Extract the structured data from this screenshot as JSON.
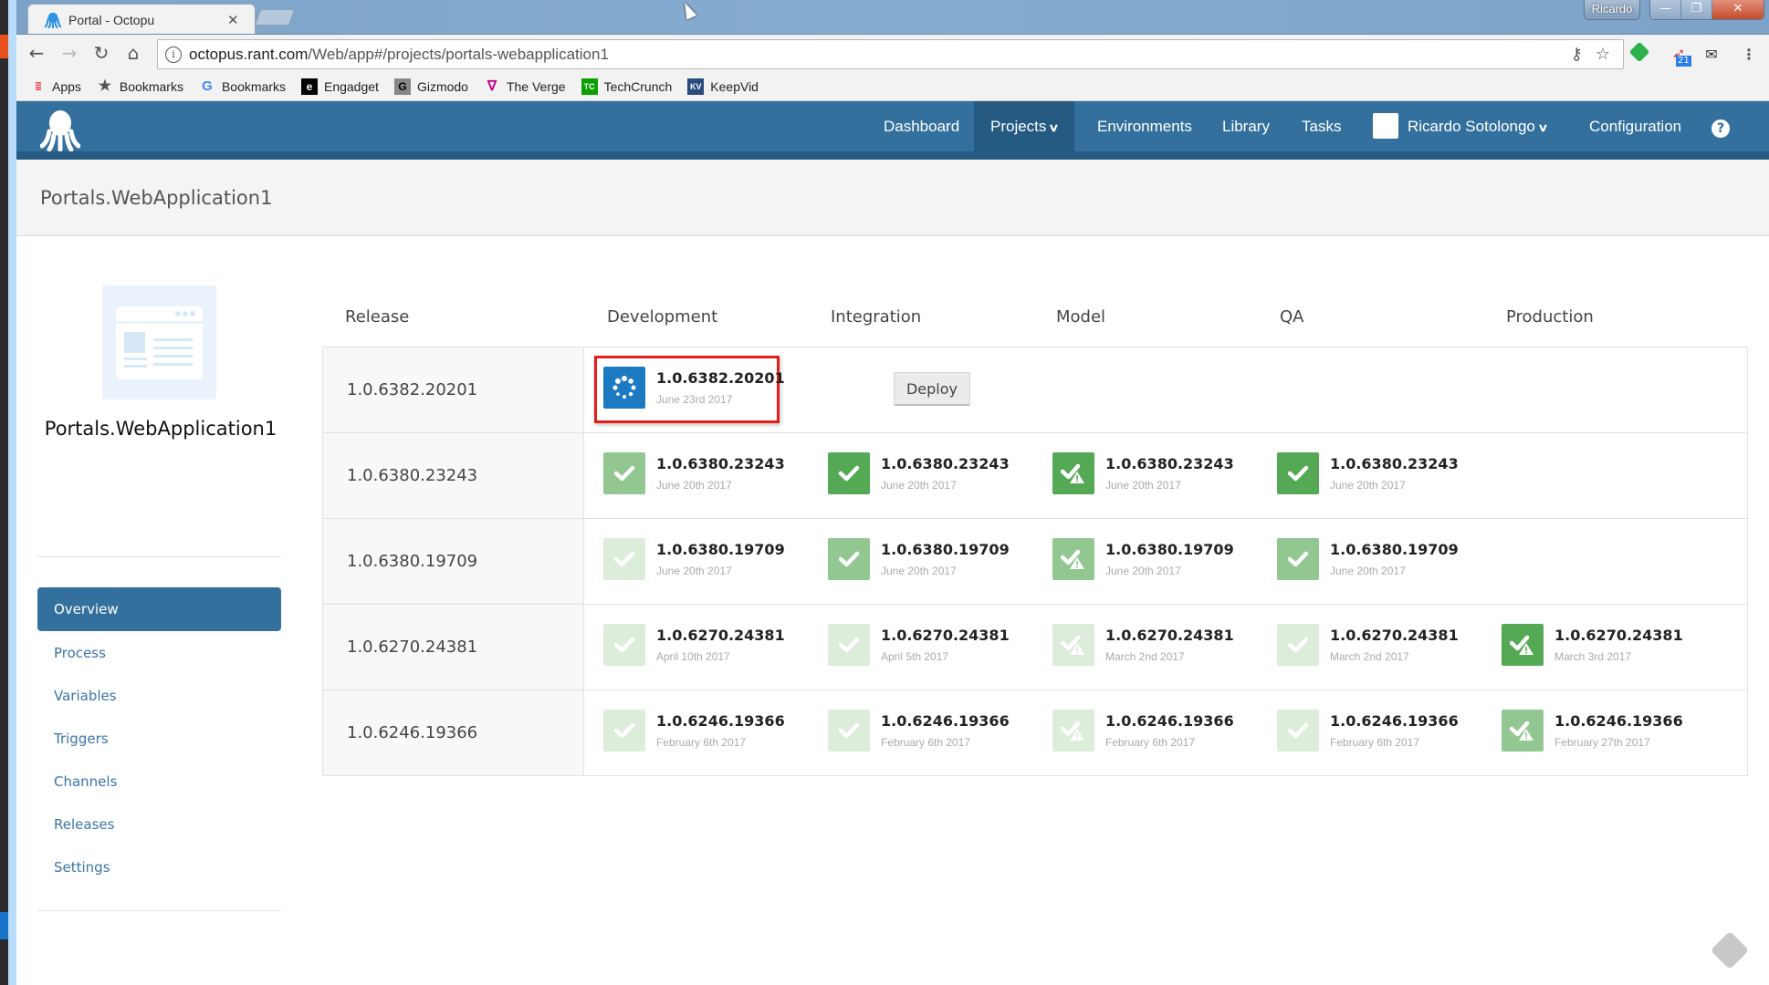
{
  "browser": {
    "tab_title": "Portal - Octopu",
    "url_host": "octopus.rant.com",
    "url_path": "/Web/app#/projects/portals-webapplication1",
    "window_user": "Ricardo",
    "extension_badge": "21",
    "window_controls": {
      "minimize": "—",
      "restore": "❐",
      "close": "✕"
    },
    "bookmarks": [
      {
        "label": "Apps",
        "icon": "apps-grid-icon"
      },
      {
        "label": "Bookmarks",
        "icon": "star-icon"
      },
      {
        "label": "Bookmarks",
        "icon": "google-icon"
      },
      {
        "label": "Engadget",
        "icon": "engadget-icon"
      },
      {
        "label": "Gizmodo",
        "icon": "gizmodo-icon"
      },
      {
        "label": "The Verge",
        "icon": "verge-icon"
      },
      {
        "label": "TechCrunch",
        "icon": "techcrunch-icon"
      },
      {
        "label": "KeepVid",
        "icon": "keepvid-icon"
      }
    ]
  },
  "nav": {
    "items": [
      {
        "label": "Dashboard"
      },
      {
        "label": "Projects",
        "active": true,
        "dropdown": true
      },
      {
        "label": "Environments"
      },
      {
        "label": "Library"
      },
      {
        "label": "Tasks"
      },
      {
        "label": "Ricardo Sotolongo",
        "dropdown": true
      },
      {
        "label": "Configuration"
      }
    ],
    "help_label": "?"
  },
  "page": {
    "title": "Portals.WebApplication1",
    "project_name": "Portals.WebApplication1"
  },
  "sidebar": {
    "items": [
      {
        "label": "Overview",
        "active": true
      },
      {
        "label": "Process"
      },
      {
        "label": "Variables"
      },
      {
        "label": "Triggers"
      },
      {
        "label": "Channels"
      },
      {
        "label": "Releases"
      },
      {
        "label": "Settings"
      }
    ]
  },
  "dashboard": {
    "columns": [
      "Release",
      "Development",
      "Integration",
      "Model",
      "QA",
      "Production"
    ],
    "deploy_label": "Deploy",
    "status_colors": {
      "in_progress": "#1b7ac2",
      "success_current": "#55a955",
      "success_previous": "#92c792",
      "success_old": "#dcedda"
    },
    "rows": [
      {
        "release": "1.0.6382.20201",
        "cells": [
          {
            "env": "Development",
            "version": "1.0.6382.20201",
            "date": "June 23rd 2017",
            "status": "in_progress",
            "highlighted": true
          },
          {
            "env": "Integration",
            "action": "deploy"
          }
        ]
      },
      {
        "release": "1.0.6380.23243",
        "cells": [
          {
            "env": "Development",
            "version": "1.0.6380.23243",
            "date": "June 20th 2017",
            "status": "success",
            "level": "previous"
          },
          {
            "env": "Integration",
            "version": "1.0.6380.23243",
            "date": "June 20th 2017",
            "status": "success",
            "level": "current"
          },
          {
            "env": "Model",
            "version": "1.0.6380.23243",
            "date": "June 20th 2017",
            "status": "success_with_warnings",
            "level": "current"
          },
          {
            "env": "QA",
            "version": "1.0.6380.23243",
            "date": "June 20th 2017",
            "status": "success",
            "level": "current"
          }
        ]
      },
      {
        "release": "1.0.6380.19709",
        "cells": [
          {
            "env": "Development",
            "version": "1.0.6380.19709",
            "date": "June 20th 2017",
            "status": "success",
            "level": "old"
          },
          {
            "env": "Integration",
            "version": "1.0.6380.19709",
            "date": "June 20th 2017",
            "status": "success",
            "level": "previous"
          },
          {
            "env": "Model",
            "version": "1.0.6380.19709",
            "date": "June 20th 2017",
            "status": "success_with_warnings",
            "level": "previous"
          },
          {
            "env": "QA",
            "version": "1.0.6380.19709",
            "date": "June 20th 2017",
            "status": "success",
            "level": "previous"
          }
        ]
      },
      {
        "release": "1.0.6270.24381",
        "cells": [
          {
            "env": "Development",
            "version": "1.0.6270.24381",
            "date": "April 10th 2017",
            "status": "success",
            "level": "old"
          },
          {
            "env": "Integration",
            "version": "1.0.6270.24381",
            "date": "April 5th 2017",
            "status": "success",
            "level": "old"
          },
          {
            "env": "Model",
            "version": "1.0.6270.24381",
            "date": "March 2nd 2017",
            "status": "success_with_warnings",
            "level": "old"
          },
          {
            "env": "QA",
            "version": "1.0.6270.24381",
            "date": "March 2nd 2017",
            "status": "success",
            "level": "old"
          },
          {
            "env": "Production",
            "version": "1.0.6270.24381",
            "date": "March 3rd 2017",
            "status": "success_with_warnings",
            "level": "current"
          }
        ]
      },
      {
        "release": "1.0.6246.19366",
        "cells": [
          {
            "env": "Development",
            "version": "1.0.6246.19366",
            "date": "February 6th 2017",
            "status": "success",
            "level": "old"
          },
          {
            "env": "Integration",
            "version": "1.0.6246.19366",
            "date": "February 6th 2017",
            "status": "success",
            "level": "old"
          },
          {
            "env": "Model",
            "version": "1.0.6246.19366",
            "date": "February 6th 2017",
            "status": "success_with_warnings",
            "level": "old"
          },
          {
            "env": "QA",
            "version": "1.0.6246.19366",
            "date": "February 6th 2017",
            "status": "success",
            "level": "old"
          },
          {
            "env": "Production",
            "version": "1.0.6246.19366",
            "date": "February 27th 2017",
            "status": "success_with_warnings",
            "level": "previous"
          }
        ]
      }
    ]
  }
}
